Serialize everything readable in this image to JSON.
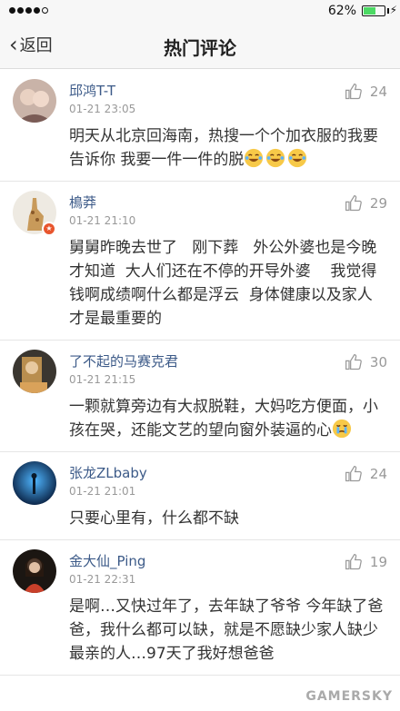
{
  "status": {
    "battery_pct": "62%",
    "battery_level": 0.62
  },
  "nav": {
    "back_label": "返回",
    "title": "热门评论"
  },
  "comments": [
    {
      "name": "邱鸿T-T",
      "time": "01-21 23:05",
      "likes": "24",
      "text": "明天从北京回海南，热搜一个个加衣服的我要告诉你 我要一件一件的脱",
      "emoji": [
        "laugh-cry-emoji",
        "laugh-cry-emoji",
        "laugh-cry-emoji"
      ]
    },
    {
      "name": "樢莽",
      "time": "01-21 21:10",
      "likes": "29",
      "text": "舅舅昨晚去世了   刚下葬   外公外婆也是今晚才知道  大人们还在不停的开导外婆    我觉得钱啊成绩啊什么都是浮云  身体健康以及家人才是最重要的",
      "emoji": []
    },
    {
      "name": "了不起的马赛克君",
      "time": "01-21 21:15",
      "likes": "30",
      "text": "一颗就算旁边有大叔脱鞋，大妈吃方便面，小孩在哭，还能文艺的望向窗外装逼的心",
      "emoji": [
        "crying-emoji"
      ]
    },
    {
      "name": "张龙ZLbaby",
      "time": "01-21 21:01",
      "likes": "24",
      "text": "只要心里有，什么都不缺",
      "emoji": []
    },
    {
      "name": "金大仙_Ping",
      "time": "01-21 22:31",
      "likes": "19",
      "text": "是啊…又快过年了，去年缺了爷爷 今年缺了爸爸，我什么都可以缺，就是不愿缺少家人缺少最亲的人…97天了我好想爸爸",
      "emoji": []
    }
  ],
  "watermark": "GAMERSKY"
}
